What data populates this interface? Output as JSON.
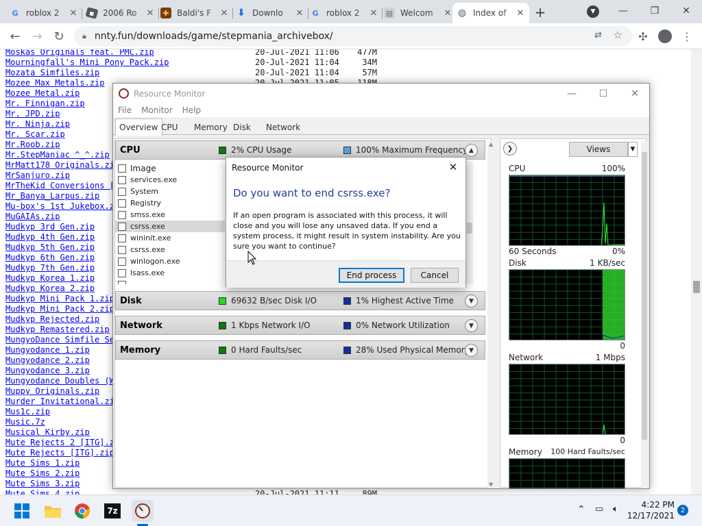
{
  "browser": {
    "tabs": [
      {
        "label": "roblox 2",
        "icon": "google-icon"
      },
      {
        "label": "2006 Ro",
        "icon": "roblox-icon"
      },
      {
        "label": "Baldi's F",
        "icon": "baldi-icon"
      },
      {
        "label": "Downlo",
        "icon": "download-icon"
      },
      {
        "label": "roblox 2",
        "icon": "google-icon"
      },
      {
        "label": "Welcom",
        "icon": "page-icon"
      },
      {
        "label": "Index of",
        "icon": "globe-icon"
      }
    ],
    "url": "nnty.fun/downloads/game/stepmania_archivebox/"
  },
  "files": [
    {
      "name": "Moskas Originals feat. PMC.zip",
      "date": "20-Jul-2021 11:06",
      "size": "477M"
    },
    {
      "name": "Mourningfall's Mini Pony Pack.zip",
      "date": "20-Jul-2021 11:04",
      "size": "34M"
    },
    {
      "name": "Mozata Simfiles.zip",
      "date": "20-Jul-2021 11:04",
      "size": "57M"
    },
    {
      "name": "Mozee Max Metals.zip",
      "date": "20-Jul-2021 11:05",
      "size": "118M"
    },
    {
      "name": "Mozee Metal.zip",
      "date": "",
      "size": ""
    },
    {
      "name": "Mr. Finnigan.zip",
      "date": "",
      "size": ""
    },
    {
      "name": "Mr. JPD.zip",
      "date": "",
      "size": ""
    },
    {
      "name": "Mr. Ninja.zip",
      "date": "",
      "size": ""
    },
    {
      "name": "Mr. Scar.zip",
      "date": "",
      "size": ""
    },
    {
      "name": "Mr.Roob.zip",
      "date": "",
      "size": ""
    },
    {
      "name": "Mr.StepManiac ^_^.zip",
      "date": "",
      "size": ""
    },
    {
      "name": "MrMatt178 Originals.zip",
      "date": "",
      "size": ""
    },
    {
      "name": "MrSanjuro.zip",
      "date": "",
      "size": ""
    },
    {
      "name": "MrTheKid Conversions [",
      "date": "",
      "size": ""
    },
    {
      "name": "Mr_Banya_Larpus.zip",
      "date": "",
      "size": ""
    },
    {
      "name": "Mu-box's 1st Jukebox.zip",
      "date": "",
      "size": ""
    },
    {
      "name": "MuGAIAs.zip",
      "date": "",
      "size": ""
    },
    {
      "name": "Mudkyp 3rd Gen.zip",
      "date": "",
      "size": ""
    },
    {
      "name": "Mudkyp 4th Gen.zip",
      "date": "",
      "size": ""
    },
    {
      "name": "Mudkyp 5th Gen.zip",
      "date": "",
      "size": ""
    },
    {
      "name": "Mudkyp 6th Gen.zip",
      "date": "",
      "size": ""
    },
    {
      "name": "Mudkyp 7th Gen.zip",
      "date": "",
      "size": ""
    },
    {
      "name": "Mudkyp Korea 1.zip",
      "date": "",
      "size": ""
    },
    {
      "name": "Mudkyp Korea 2.zip",
      "date": "",
      "size": ""
    },
    {
      "name": "Mudkyp Mini Pack 1.zip",
      "date": "",
      "size": ""
    },
    {
      "name": "Mudkyp Mini Pack 2.zip",
      "date": "",
      "size": ""
    },
    {
      "name": "Mudkyp Rejected.zip",
      "date": "",
      "size": ""
    },
    {
      "name": "Mudkyp Remastered.zip",
      "date": "",
      "size": ""
    },
    {
      "name": "MungyoDance Simfile Se",
      "date": "",
      "size": ""
    },
    {
      "name": "Mungyodance 1.zip",
      "date": "",
      "size": ""
    },
    {
      "name": "Mungyodance 2.zip",
      "date": "",
      "size": ""
    },
    {
      "name": "Mungyodance 3.zip",
      "date": "",
      "size": ""
    },
    {
      "name": "Mungyodance Doubles (W",
      "date": "",
      "size": ""
    },
    {
      "name": "Muppy Originals.zip",
      "date": "",
      "size": ""
    },
    {
      "name": "Murder Invitational.zip",
      "date": "",
      "size": ""
    },
    {
      "name": "Mus1c.zip",
      "date": "",
      "size": ""
    },
    {
      "name": "Music.7z",
      "date": "",
      "size": ""
    },
    {
      "name": "Musical Kirby.zip",
      "date": "",
      "size": ""
    },
    {
      "name": "Mute Rejects 2 [ITG].zip",
      "date": "",
      "size": ""
    },
    {
      "name": "Mute Rejects [ITG].zip",
      "date": "",
      "size": ""
    },
    {
      "name": "Mute Sims 1.zip",
      "date": "",
      "size": ""
    },
    {
      "name": "Mute Sims 2.zip",
      "date": "",
      "size": ""
    },
    {
      "name": "Mute Sims 3.zip",
      "date": "",
      "size": ""
    },
    {
      "name": "Mute Sims 4.zip",
      "date": "20-Jul-2021 11:11",
      "size": "89M"
    }
  ],
  "resmon": {
    "title": "Resource Monitor",
    "menu": [
      "File",
      "Monitor",
      "Help"
    ],
    "tabs": [
      "Overview",
      "CPU",
      "Memory",
      "Disk",
      "Network"
    ],
    "sections": [
      {
        "name": "CPU",
        "metric1": "2% CPU Usage",
        "metric1_color": "#0c7a0c",
        "metric2": "100% Maximum Frequency",
        "metric2_color": "#5aa0e0",
        "expanded": true
      },
      {
        "name": "Disk",
        "metric1": "69632 B/sec Disk I/O",
        "metric1_color": "#22dd22",
        "metric2": "1% Highest Active Time",
        "metric2_color": "#1030a0"
      },
      {
        "name": "Network",
        "metric1": "1 Kbps Network I/O",
        "metric1_color": "#0c7a0c",
        "metric2": "0% Network Utilization",
        "metric2_color": "#1030a0"
      },
      {
        "name": "Memory",
        "metric1": "0 Hard Faults/sec",
        "metric1_color": "#0c7a0c",
        "metric2": "28% Used Physical Memory",
        "metric2_color": "#1030a0"
      }
    ],
    "processes": [
      "Image",
      "services.exe",
      "System",
      "Registry",
      "smss.exe",
      "csrss.exe",
      "wininit.exe",
      "csrss.exe",
      "winlogon.exe",
      "lsass.exe"
    ],
    "views_label": "Views",
    "graphs": [
      {
        "label": "CPU",
        "value": "100%",
        "bottom_left": "60 Seconds",
        "bottom_right": "0%"
      },
      {
        "label": "Disk",
        "value": "1 KB/sec",
        "bottom_right": "0"
      },
      {
        "label": "Network",
        "value": "1 Mbps",
        "bottom_right": "0"
      },
      {
        "label": "Memory",
        "value": "100 Hard Faults/sec"
      }
    ]
  },
  "dialog": {
    "title": "Resource Monitor",
    "heading": "Do you want to end csrss.exe?",
    "body": "If an open program is associated with this process, it will close and you will lose any unsaved data. If you end a system process, it might result in system instability. Are you sure you want to continue?",
    "confirm": "End process",
    "cancel": "Cancel"
  },
  "taskbar": {
    "time": "4:22 PM",
    "date": "12/17/2021",
    "notifications": "2"
  }
}
